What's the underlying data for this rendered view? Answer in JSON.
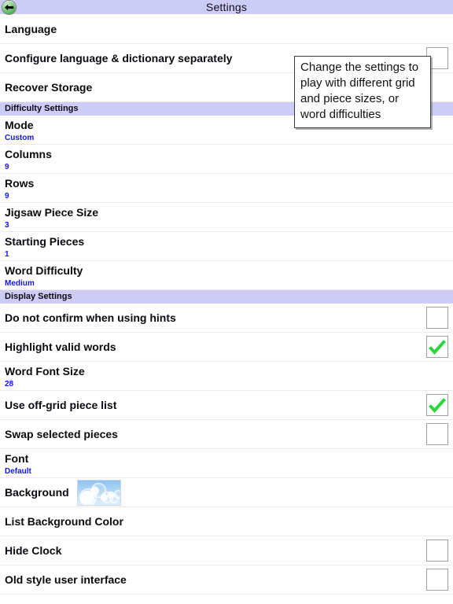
{
  "window": {
    "title": "Settings",
    "back_icon": "arrow-left-icon",
    "header_bg": "#ccccf7",
    "accent_value_color": "#1414f0",
    "check_color": "#2bd73c"
  },
  "tooltip": {
    "text": "Change the settings to play with different grid and piece sizes, or word difficulties"
  },
  "sections": [
    {
      "header": null,
      "rows": [
        {
          "label": "Language",
          "type": "plain"
        },
        {
          "label": "Configure language & dictionary separately",
          "type": "toggle",
          "checked": false
        },
        {
          "label": "Recover Storage",
          "type": "plain"
        }
      ]
    },
    {
      "header": "Difficulty Settings",
      "rows": [
        {
          "label": "Mode",
          "type": "valued",
          "value": "Custom"
        },
        {
          "label": "Columns",
          "type": "valued",
          "value": "9"
        },
        {
          "label": "Rows",
          "type": "valued",
          "value": "9"
        },
        {
          "label": "Jigsaw Piece Size",
          "type": "valued",
          "value": "3"
        },
        {
          "label": "Starting Pieces",
          "type": "valued",
          "value": "1"
        },
        {
          "label": "Word Difficulty",
          "type": "valued",
          "value": "Medium"
        }
      ]
    },
    {
      "header": "Display Settings",
      "rows": [
        {
          "label": "Do not confirm when using hints",
          "type": "toggle",
          "checked": false
        },
        {
          "label": "Highlight valid words",
          "type": "toggle",
          "checked": true
        },
        {
          "label": "Word Font Size",
          "type": "valued",
          "value": "28"
        },
        {
          "label": "Use off-grid piece list",
          "type": "toggle",
          "checked": true
        },
        {
          "label": "Swap selected pieces",
          "type": "toggle",
          "checked": false
        },
        {
          "label": "Font",
          "type": "valued",
          "value": "Default"
        },
        {
          "label": "Background",
          "type": "thumb",
          "thumb_name": "bubbles-background-thumbnail"
        },
        {
          "label": "List Background Color",
          "type": "plain"
        },
        {
          "label": "Hide Clock",
          "type": "toggle",
          "checked": false
        },
        {
          "label": "Old style user interface",
          "type": "toggle",
          "checked": false
        }
      ]
    }
  ]
}
